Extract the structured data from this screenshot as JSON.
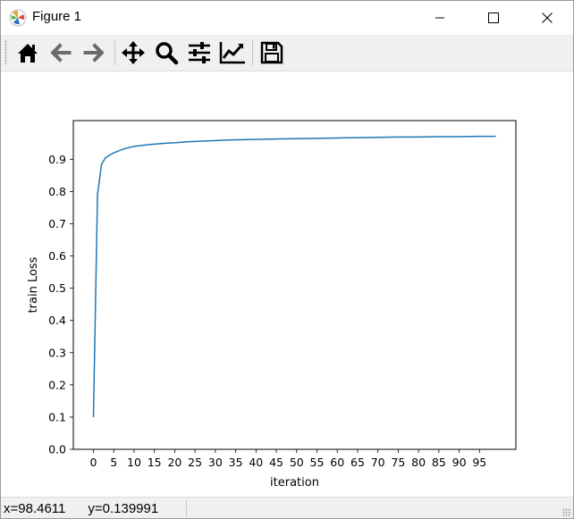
{
  "window": {
    "title": "Figure 1",
    "icons": [
      "matplotlib-logo-icon",
      "minimize-icon",
      "maximize-icon",
      "close-icon"
    ]
  },
  "toolbar": {
    "buttons": [
      {
        "name": "home",
        "icon": "home-icon"
      },
      {
        "name": "back",
        "icon": "arrow-left-icon"
      },
      {
        "name": "forward",
        "icon": "arrow-right-icon"
      },
      {
        "name": "pan",
        "icon": "move-icon"
      },
      {
        "name": "zoom",
        "icon": "magnifier-icon"
      },
      {
        "name": "subplots",
        "icon": "sliders-icon"
      },
      {
        "name": "customize",
        "icon": "chart-edit-icon"
      },
      {
        "name": "save",
        "icon": "floppy-disk-icon"
      }
    ]
  },
  "status": {
    "coords": "x=98.4611      y=0.139991"
  },
  "chart_data": {
    "type": "line",
    "xlabel": "iteration",
    "ylabel": "train Loss",
    "xlim": [
      -4.95,
      103.95
    ],
    "ylim": [
      0.0,
      1.02
    ],
    "x_ticks": [
      0,
      5,
      10,
      15,
      20,
      25,
      30,
      35,
      40,
      45,
      50,
      55,
      60,
      65,
      70,
      75,
      80,
      85,
      90,
      95
    ],
    "y_ticks": [
      0.0,
      0.1,
      0.2,
      0.3,
      0.4,
      0.5,
      0.6,
      0.7,
      0.8,
      0.9
    ],
    "x_tick_labels": [
      "0",
      "5",
      "10",
      "15",
      "20",
      "25",
      "30",
      "35",
      "40",
      "45",
      "50",
      "55",
      "60",
      "65",
      "70",
      "75",
      "80",
      "85",
      "90",
      "95"
    ],
    "y_tick_labels": [
      "0.0",
      "0.1",
      "0.2",
      "0.3",
      "0.4",
      "0.5",
      "0.6",
      "0.7",
      "0.8",
      "0.9"
    ],
    "grid": false,
    "line_color": "#1f77b4",
    "series": [
      {
        "x": [
          0,
          1,
          2,
          3,
          4,
          5,
          6,
          7,
          8,
          9,
          10,
          12,
          14,
          16,
          18,
          20,
          23,
          26,
          30,
          34,
          38,
          42,
          46,
          50,
          55,
          60,
          65,
          70,
          75,
          80,
          85,
          90,
          95,
          99
        ],
        "y": [
          0.1,
          0.79,
          0.885,
          0.905,
          0.913,
          0.92,
          0.925,
          0.93,
          0.934,
          0.937,
          0.94,
          0.943,
          0.946,
          0.948,
          0.95,
          0.951,
          0.954,
          0.956,
          0.958,
          0.96,
          0.961,
          0.962,
          0.963,
          0.964,
          0.965,
          0.966,
          0.967,
          0.968,
          0.969,
          0.969,
          0.97,
          0.97,
          0.971,
          0.971
        ]
      }
    ]
  }
}
